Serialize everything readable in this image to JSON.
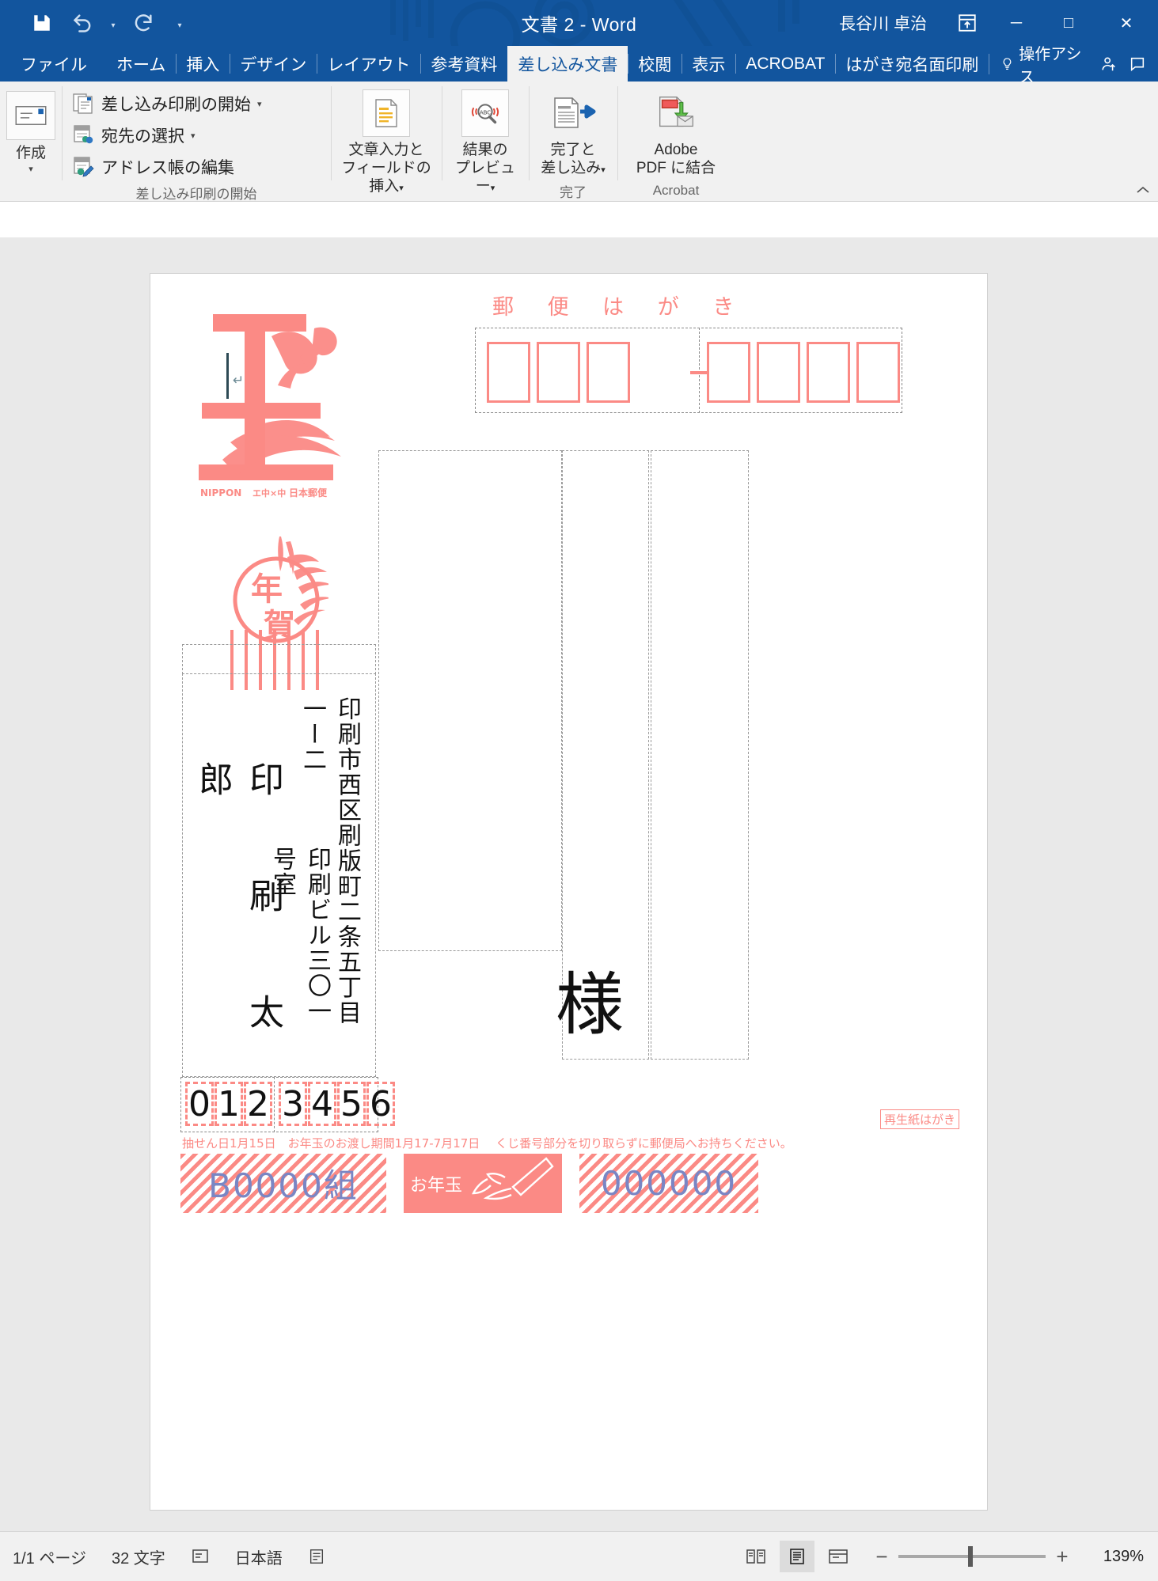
{
  "titlebar": {
    "save_icon": "save-icon",
    "undo_icon": "undo-icon",
    "redo_icon": "redo-icon",
    "customize_icon": "chevron-down-icon",
    "title": "文書 2  -  Word",
    "user": "長谷川 卓治",
    "ribbon_display_icon": "ribbon-display-options-icon",
    "minimize": "─",
    "maximize": "□",
    "close": "✕"
  },
  "tabs": [
    {
      "label": "ファイル",
      "active": false
    },
    {
      "label": "ホーム",
      "active": false
    },
    {
      "label": "挿入",
      "active": false
    },
    {
      "label": "デザイン",
      "active": false
    },
    {
      "label": "レイアウト",
      "active": false
    },
    {
      "label": "参考資料",
      "active": false
    },
    {
      "label": "差し込み文書",
      "active": true
    },
    {
      "label": "校閲",
      "active": false
    },
    {
      "label": "表示",
      "active": false
    },
    {
      "label": "ACROBAT",
      "active": false
    },
    {
      "label": "はがき宛名面印刷",
      "active": false
    }
  ],
  "tell_me": {
    "label": "操作アシス",
    "icon": "lightbulb-icon"
  },
  "tab_tools": {
    "share_icon": "person-share-icon",
    "comment_icon": "comment-icon"
  },
  "ribbon": {
    "groups": [
      {
        "name": "create",
        "label": "作成",
        "big_button": {
          "label": "作成",
          "icon": "envelope-icon",
          "caret": "▾"
        }
      },
      {
        "name": "start-mail-merge",
        "label": "差し込み印刷の開始",
        "items": [
          {
            "label": "差し込み印刷の開始",
            "icon": "mail-merge-start-icon",
            "caret": "▾"
          },
          {
            "label": "宛先の選択",
            "icon": "select-recipients-icon",
            "caret": "▾"
          },
          {
            "label": "アドレス帳の編集",
            "icon": "edit-recipient-list-icon",
            "caret": ""
          }
        ]
      },
      {
        "name": "write-insert-fields",
        "label": "",
        "big_button": {
          "line1": "文章入力と",
          "line2": "フィールドの挿入",
          "icon": "insert-field-icon",
          "caret": "▾"
        }
      },
      {
        "name": "preview-results",
        "label": "",
        "big_button": {
          "line1": "結果の",
          "line2": "プレビュー",
          "icon": "preview-abc-icon",
          "caret": "▾"
        }
      },
      {
        "name": "finish",
        "label": "完了",
        "big_button": {
          "line1": "完了と",
          "line2": "差し込み",
          "icon": "finish-merge-icon",
          "caret": "▾"
        }
      },
      {
        "name": "acrobat",
        "label": "Acrobat",
        "big_button": {
          "line1": "Adobe",
          "line2": "PDF に結合",
          "icon": "adobe-merge-pdf-icon",
          "caret": ""
        }
      }
    ],
    "collapse_icon": "chevron-up-icon"
  },
  "document": {
    "postal_header": "郵 便 は が き",
    "zip_digits": [
      "",
      "",
      "",
      "",
      "",
      "",
      ""
    ],
    "stamp": {
      "denomination_label": "年賀",
      "issuer": "NIPPON 日本郵便",
      "icon": "new-year-stamp-icon"
    },
    "address": {
      "line1": "印刷市西区刷版町二条五丁目一ー二",
      "line2": "印刷ビル三〇一号室",
      "name": "印 刷  太 郎",
      "honorific": "様"
    },
    "lottery": {
      "number_digits": [
        "0",
        "1",
        "2",
        "3",
        "4",
        "5",
        "6"
      ],
      "note": "抽せん日1月15日　お年玉のお渡し期間1月17-7月17日　 くじ番号部分を切り取らずに郵便局へお持ちください。",
      "recycle_mark": "再生紙はがき",
      "group_code": "B0000組",
      "otoshidama_label": "お年玉",
      "serial": "000000"
    }
  },
  "statusbar": {
    "page": "1/1 ページ",
    "words": "32 文字",
    "proofing_icon": "proofing-errors-icon",
    "language": "日本語",
    "accessibility_icon": "accessibility-icon",
    "views": [
      {
        "name": "read-mode",
        "icon": "read-mode-icon",
        "active": false
      },
      {
        "name": "print-layout",
        "icon": "print-layout-icon",
        "active": true
      },
      {
        "name": "web-layout",
        "icon": "web-layout-icon",
        "active": false
      }
    ],
    "zoom_out": "−",
    "zoom_in": "+",
    "zoom_value": "139%"
  }
}
